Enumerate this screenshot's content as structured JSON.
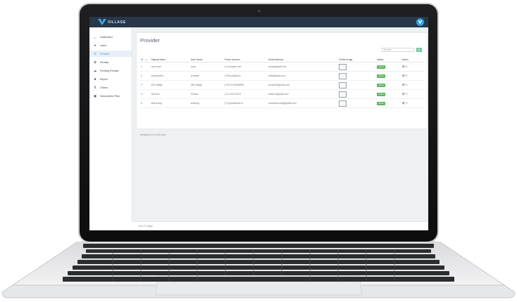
{
  "app": {
    "logo_text": "VILLAGE"
  },
  "colors": {
    "topbar": "#29374a",
    "accent": "#2e9fe0",
    "status_active": "#5cb85c",
    "search_button": "#6ccba0"
  },
  "sidebar": {
    "items": [
      {
        "icon": "dashboard-icon",
        "label": "Dashboard",
        "active": false
      },
      {
        "icon": "users-icon",
        "label": "Users",
        "active": false
      },
      {
        "icon": "provider-icon",
        "label": "Provider",
        "active": true
      },
      {
        "icon": "rentals-icon",
        "label": "Rentals",
        "active": false
      },
      {
        "icon": "pending-rentals-icon",
        "label": "Pending Rentals",
        "active": false
      },
      {
        "icon": "report-icon",
        "label": "Report",
        "active": false
      },
      {
        "icon": "orders-icon",
        "label": "Orders",
        "active": false
      },
      {
        "icon": "subscription-icon",
        "label": "Subscription Plan",
        "active": false
      }
    ]
  },
  "main": {
    "title": "Provider",
    "search_placeholder": "Search",
    "columns": [
      "Id",
      "Display Name",
      "User Name",
      "Phone Number",
      "Email Address",
      "Profile Image",
      "Status",
      "Action"
    ],
    "rows": [
      {
        "id": "1",
        "display": "onna.com",
        "user": "onna",
        "phone": "(+1) lokadu.com",
        "email": "anna@gmail.com",
        "status": "Active"
      },
      {
        "id": "2",
        "display": "testprovider",
        "user": "provider",
        "phone": "(+91) juhaida.in",
        "email": "test@gmail.com",
        "status": "Active"
      },
      {
        "id": "3",
        "display": "IDE Village",
        "user": "IDE Village",
        "phone": "(+91) 9740918868",
        "email": "provider@gmail.com",
        "status": "Active"
      },
      {
        "id": "4",
        "display": "Test Acc",
        "user": "Testacc",
        "phone": "(+1) 123123123",
        "email": "testacc@gmail.com",
        "status": "Active"
      },
      {
        "id": "5",
        "display": "andra.sing",
        "user": "andrasg",
        "phone": "(+1) jhdolaksdu.in",
        "email": "andrasina.sing@gmail.com",
        "status": "Active"
      }
    ],
    "showing": "Showing 1 to 5 of 5 rows"
  },
  "footer": {
    "text": "2019 © village"
  }
}
